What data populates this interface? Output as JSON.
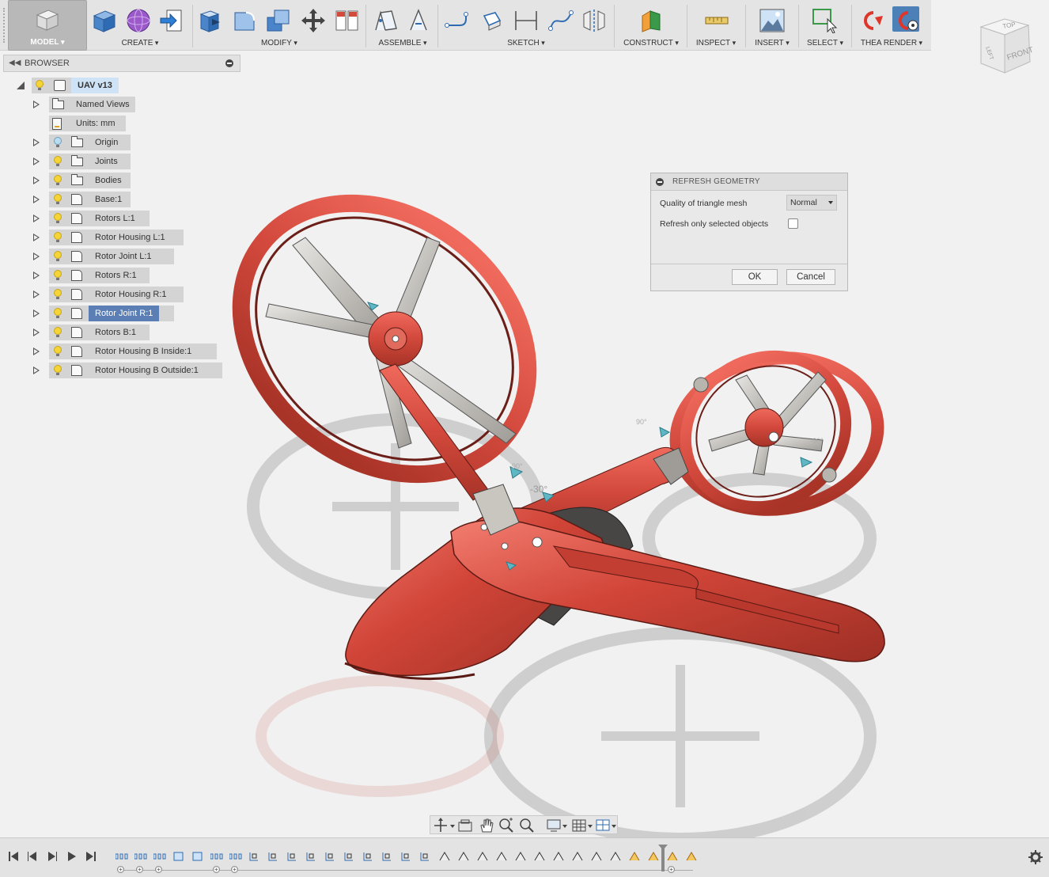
{
  "toolbar": {
    "model": "MODEL",
    "groups": {
      "create": "CREATE",
      "modify": "MODIFY",
      "assemble": "ASSEMBLE",
      "sketch": "SKETCH",
      "construct": "CONSTRUCT",
      "inspect": "INSPECT",
      "insert": "INSERT",
      "select": "SELECT",
      "thea_render": "THEA RENDER"
    },
    "icons": {
      "create": [
        "box-icon",
        "sphere-icon",
        "insert-arrow-icon"
      ],
      "modify": [
        "press-pull-icon",
        "fillet-icon",
        "combine-icon",
        "move-icon",
        "appearance-icon"
      ],
      "assemble": [
        "new-component-icon",
        "joint-icon"
      ],
      "sketch": [
        "line-icon",
        "rectangle-icon",
        "dimension-icon",
        "spline-icon",
        "mirror-icon"
      ]
    }
  },
  "browser": {
    "title": "BROWSER",
    "root": {
      "label": "UAV v13"
    },
    "items": [
      {
        "label": "Named Views",
        "icon": "folder-icon",
        "bulb": "none",
        "expandable": true,
        "selected": false
      },
      {
        "label": "Units: mm",
        "icon": "document-icon",
        "bulb": "none",
        "expandable": false,
        "selected": false
      },
      {
        "label": "Origin",
        "icon": "folder-icon",
        "bulb": "off",
        "expandable": true,
        "selected": false
      },
      {
        "label": "Joints",
        "icon": "folder-icon",
        "bulb": "on",
        "expandable": true,
        "selected": false
      },
      {
        "label": "Bodies",
        "icon": "folder-icon",
        "bulb": "on",
        "expandable": true,
        "selected": false
      },
      {
        "label": "Base:1",
        "icon": "body-icon",
        "bulb": "on",
        "expandable": true,
        "selected": false
      },
      {
        "label": "Rotors L:1",
        "icon": "body-icon",
        "bulb": "on",
        "expandable": true,
        "selected": false
      },
      {
        "label": "Rotor Housing L:1",
        "icon": "body-icon",
        "bulb": "on",
        "expandable": true,
        "selected": false
      },
      {
        "label": "Rotor Joint L:1",
        "icon": "body-icon",
        "bulb": "on",
        "expandable": true,
        "selected": false
      },
      {
        "label": "Rotors R:1",
        "icon": "body-icon",
        "bulb": "on",
        "expandable": true,
        "selected": false
      },
      {
        "label": "Rotor Housing R:1",
        "icon": "body-icon",
        "bulb": "on",
        "expandable": true,
        "selected": false
      },
      {
        "label": "Rotor Joint R:1",
        "icon": "body-icon",
        "bulb": "on",
        "expandable": true,
        "selected": true
      },
      {
        "label": "Rotors B:1",
        "icon": "body-icon",
        "bulb": "on",
        "expandable": true,
        "selected": false
      },
      {
        "label": "Rotor Housing B Inside:1",
        "icon": "body-icon",
        "bulb": "on",
        "expandable": true,
        "selected": false
      },
      {
        "label": "Rotor Housing B Outside:1",
        "icon": "body-icon",
        "bulb": "on",
        "expandable": true,
        "selected": false
      }
    ]
  },
  "dialog": {
    "title": "REFRESH GEOMETRY",
    "quality_label": "Quality of triangle mesh",
    "quality_value": "Normal",
    "refresh_label": "Refresh only selected objects",
    "refresh_checked": false,
    "ok": "OK",
    "cancel": "Cancel"
  },
  "viewcube": {
    "top": "TOP",
    "left": "LEFT",
    "front": "FRONT"
  },
  "viewport": {
    "joint_labels": [
      "-30°",
      "-90°",
      "90°",
      "-90°"
    ],
    "model_color": "#d2483c"
  },
  "colors": {
    "accent": "#5b7fb5",
    "model_red": "#d2483c",
    "bulb_on": "#f4d437",
    "bulb_off": "#b9dcef"
  }
}
